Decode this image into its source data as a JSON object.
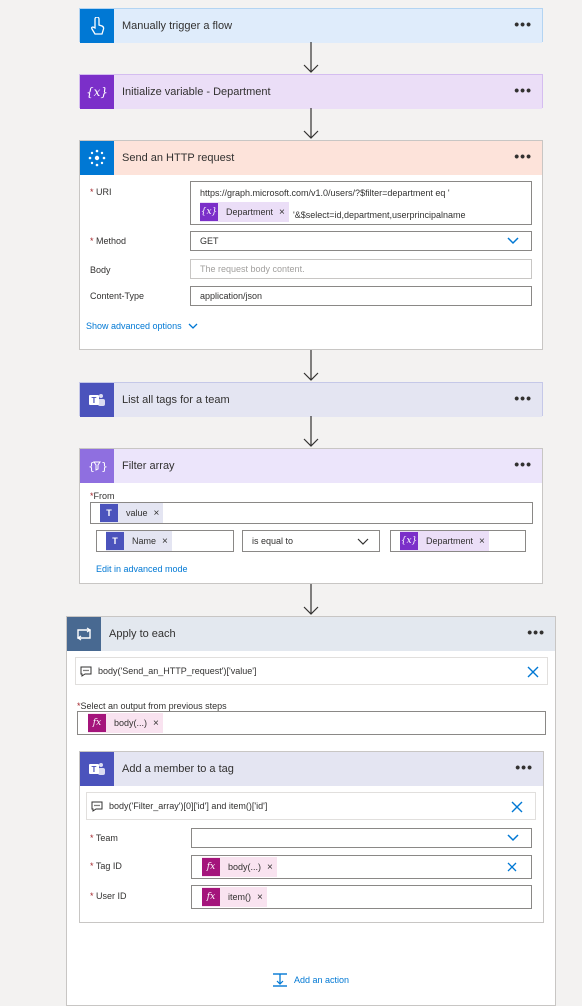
{
  "steps": {
    "trigger": {
      "title": "Manually trigger a flow",
      "color": "#0078d4",
      "bg": "#dfecfb"
    },
    "init_var": {
      "title": "Initialize variable - Department",
      "color": "#7b2fc9",
      "bg": "#ebdef7"
    },
    "http": {
      "title": "Send an HTTP request",
      "color": "#0078d4",
      "bg": "#fde3da",
      "uri_label": "URI",
      "uri_line1": "https://graph.microsoft.com/v1.0/users/?$filter=department eq '",
      "uri_token": "Department",
      "uri_line2": "'&$select=id,department,userprincipalname",
      "method_label": "Method",
      "method_value": "GET",
      "body_label": "Body",
      "body_placeholder": "The request body content.",
      "content_type_label": "Content-Type",
      "content_type_value": "application/json",
      "advanced_link": "Show advanced options"
    },
    "list_tags": {
      "title": "List all tags for a team",
      "color": "#4b53bc",
      "bg": "#e4e5f2"
    },
    "filter": {
      "title": "Filter array",
      "color": "#8f6fe0",
      "bg": "#ece5fb",
      "from_label": "From",
      "from_token": "value",
      "left_token": "Name",
      "operator": "is equal to",
      "right_token": "Department",
      "edit_link": "Edit in advanced mode"
    },
    "apply_each": {
      "title": "Apply to each",
      "color": "#486991",
      "bg": "#e3e8ef",
      "expression": "body('Send_an_HTTP_request')['value']",
      "select_label": "Select an output from previous steps",
      "output_token": "body(...)"
    },
    "add_member": {
      "title": "Add a member to a tag",
      "color": "#4b53bc",
      "bg": "#e4e5f2",
      "expression": "body('Filter_array')[0]['id'] and item()['id']",
      "team_label": "Team",
      "tag_label": "Tag ID",
      "tag_token": "body(...)",
      "user_label": "User ID",
      "user_token": "item()"
    }
  },
  "add_action": "Add an action",
  "ellipsis": "•••",
  "remove_glyph": "×"
}
